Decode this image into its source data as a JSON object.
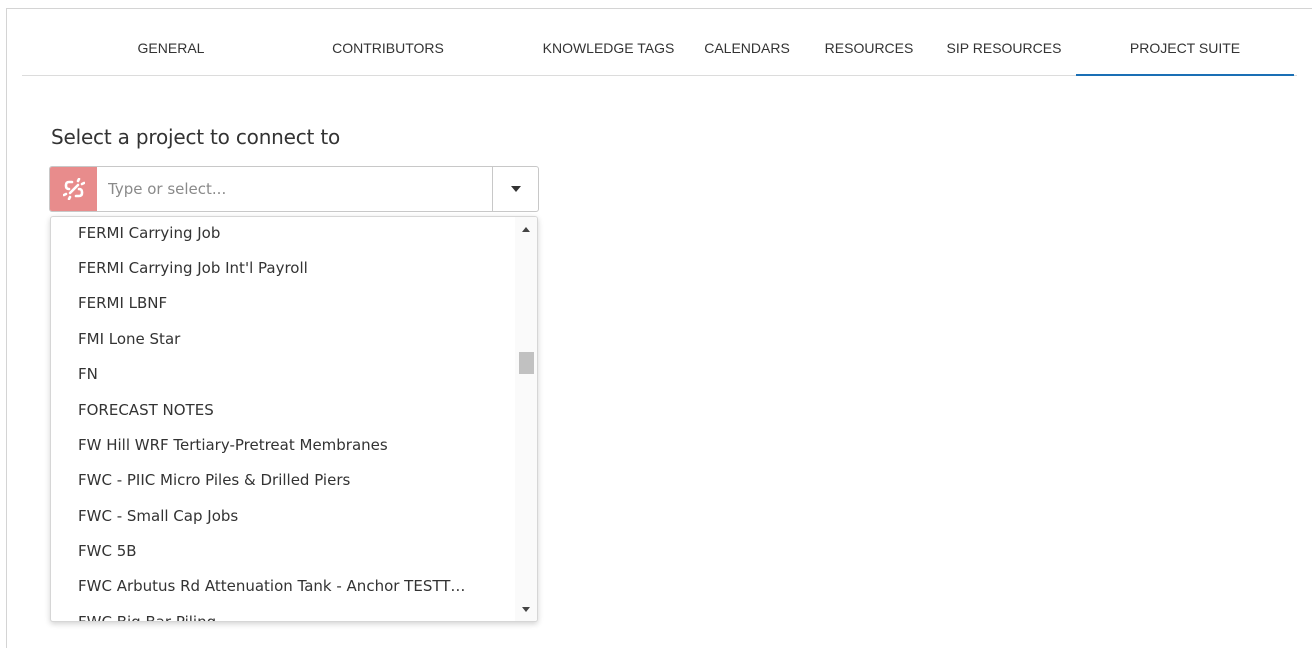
{
  "tabs": [
    {
      "label": "GENERAL",
      "active": false
    },
    {
      "label": "CONTRIBUTORS",
      "active": false
    },
    {
      "label": "KNOWLEDGE TAGS",
      "active": false
    },
    {
      "label": "CALENDARS",
      "active": false
    },
    {
      "label": "RESOURCES",
      "active": false
    },
    {
      "label": "SIP RESOURCES",
      "active": false
    },
    {
      "label": "PROJECT SUITE",
      "active": true
    }
  ],
  "project_select": {
    "heading": "Select a project to connect to",
    "placeholder": "Type or select...",
    "value": "",
    "status_icon": "broken-link-icon",
    "toggle_icon": "caret-down-icon",
    "options": [
      "FERMI Carrying Job",
      "FERMI Carrying Job Int'l Payroll",
      "FERMI LBNF",
      "FMI Lone Star",
      "FN",
      "FORECAST NOTES",
      "FW Hill WRF Tertiary-Pretreat Membranes",
      "FWC - PIIC Micro Piles & Drilled Piers",
      "FWC - Small Cap Jobs",
      "FWC 5B",
      "FWC Arbutus Rd Attenuation Tank - Anchor TESTT…",
      "FWC Big Bar Piling"
    ]
  },
  "colors": {
    "accent": "#1a6fb5",
    "status_unlinked": "#e88c8c"
  }
}
